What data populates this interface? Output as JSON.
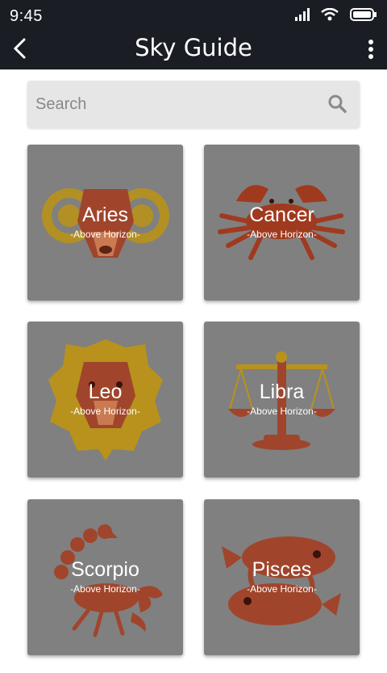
{
  "status_bar": {
    "time": "9:45",
    "icons": [
      "signal-icon",
      "wifi-icon",
      "battery-icon"
    ]
  },
  "app_bar": {
    "title": "Sky Guide",
    "back_icon": "chevron-left-icon",
    "menu_icon": "more-vert-icon"
  },
  "search": {
    "placeholder": "Search",
    "icon": "search-icon"
  },
  "signs": [
    {
      "name": "Aries",
      "status": "-Above Horizon-",
      "icon": "ram-icon"
    },
    {
      "name": "Cancer",
      "status": "-Above Horizon-",
      "icon": "crab-icon"
    },
    {
      "name": "Leo",
      "status": "-Above Horizon-",
      "icon": "lion-icon"
    },
    {
      "name": "Libra",
      "status": "-Above Horizon-",
      "icon": "scales-icon"
    },
    {
      "name": "Scorpio",
      "status": "-Above Horizon-",
      "icon": "scorpion-icon"
    },
    {
      "name": "Pisces",
      "status": "-Above Horizon-",
      "icon": "fish-icon"
    }
  ],
  "colors": {
    "bar": "#1b1d24",
    "card": "#808080",
    "search_bg": "#e6e6e6"
  }
}
